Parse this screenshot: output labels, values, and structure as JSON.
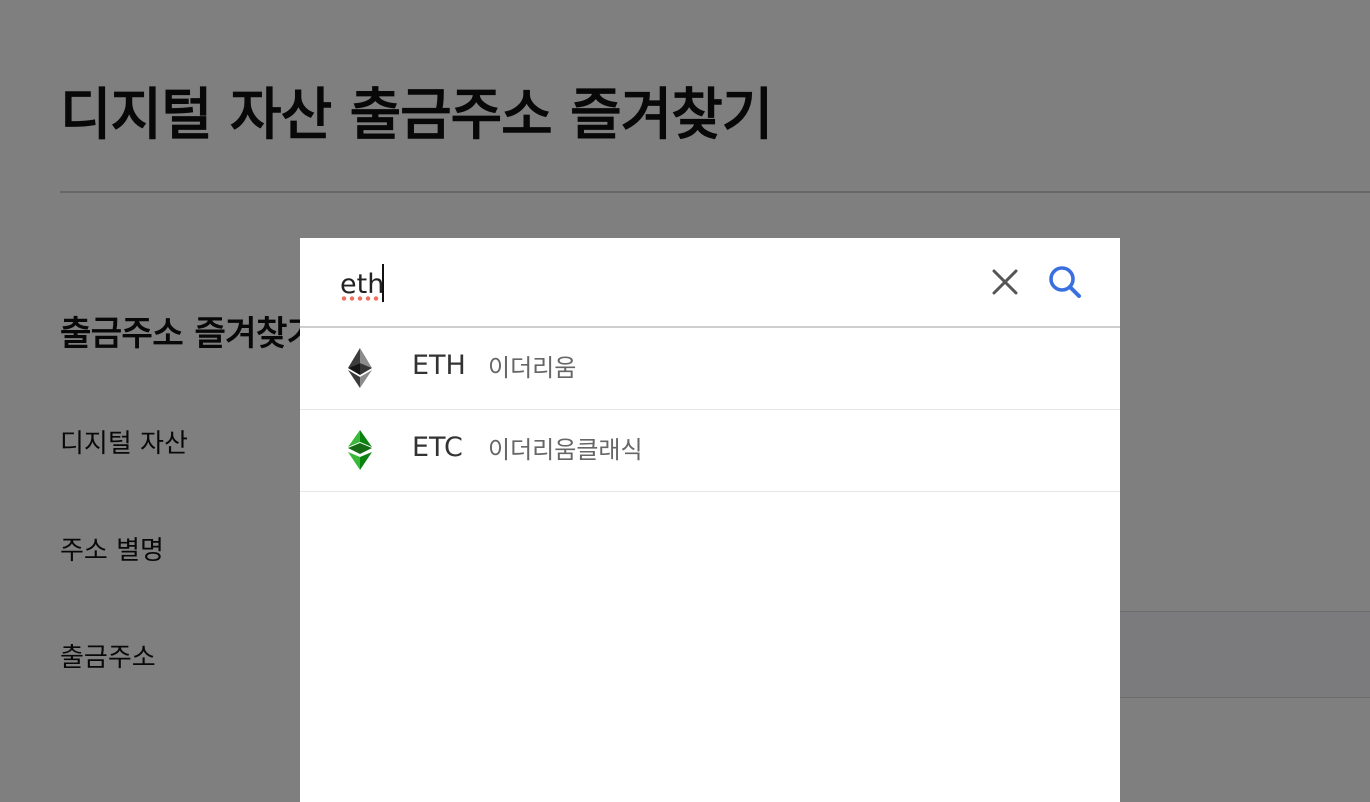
{
  "page": {
    "title": "디지털 자산 출금주소 즐겨찾기",
    "section_title": "출금주소 즐겨찾기"
  },
  "form": {
    "asset_label": "디지털 자산",
    "alias_label": "주소 별명",
    "address_label": "출금주소"
  },
  "search_modal": {
    "query": "eth",
    "clear_icon": "close-icon",
    "search_icon": "search-icon",
    "search_icon_color": "#3a6fe0",
    "results": [
      {
        "symbol": "ETH",
        "name": "이더리움",
        "icon": "ethereum-icon"
      },
      {
        "symbol": "ETC",
        "name": "이더리움클래식",
        "icon": "ethereum-classic-icon"
      }
    ]
  }
}
